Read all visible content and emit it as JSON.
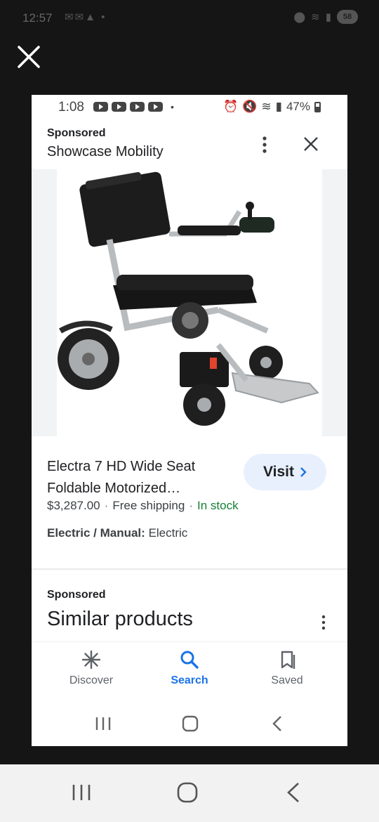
{
  "outer_status": {
    "time": "12:57",
    "battery": "58"
  },
  "inner_status": {
    "time": "1:08",
    "battery": "47%"
  },
  "ad": {
    "sponsored": "Sponsored",
    "advertiser": "Showcase Mobility",
    "product_title": "Electra 7 HD Wide Seat Foldable Motorized…",
    "visit_label": "Visit",
    "price": "$3,287.00",
    "shipping": "Free shipping",
    "stock": "In stock",
    "spec_label": "Electric / Manual:",
    "spec_value": "Electric"
  },
  "similar": {
    "sponsored": "Sponsored",
    "title": "Similar products"
  },
  "bottom_nav": {
    "discover": "Discover",
    "search": "Search",
    "saved": "Saved"
  },
  "colors": {
    "accent": "#1a73e8",
    "stock_green": "#188038",
    "visit_bg": "#e8f0fe"
  }
}
